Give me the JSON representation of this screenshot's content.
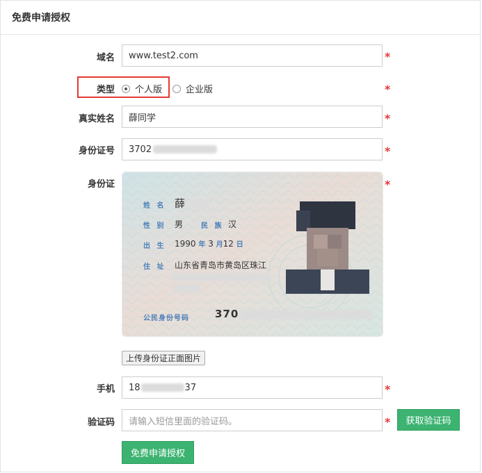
{
  "header": {
    "title": "免费申请授权"
  },
  "form": {
    "domain": {
      "label": "域名",
      "value": "www.test2.com"
    },
    "type": {
      "label": "类型",
      "options": [
        "个人版",
        "企业版"
      ],
      "selected": "个人版"
    },
    "realname": {
      "label": "真实姓名",
      "value": "薛同学"
    },
    "idnumber": {
      "label": "身份证号",
      "value": "3702"
    },
    "idcard": {
      "label": "身份证",
      "card": {
        "name_label": "姓 名",
        "name_value": "薛",
        "sex_label": "性 别",
        "sex_value": "男",
        "ethnic_label": "民 族",
        "ethnic_value": "汉",
        "birth_label": "出 生",
        "birth_year": "1990",
        "year_unit": "年",
        "birth_month": "3",
        "month_unit": "月",
        "birth_day": "12",
        "day_unit": "日",
        "addr_label": "住 址",
        "addr_value": "山东省青岛市黄岛区珠江",
        "idno_label": "公民身份号码",
        "idno_value": "370"
      }
    },
    "upload_button": "上传身份证正面图片",
    "phone": {
      "label": "手机",
      "prefix": "18",
      "suffix": "37"
    },
    "code": {
      "label": "验证码",
      "placeholder": "请输入短信里面的验证码。",
      "get_button": "获取验证码"
    },
    "required_mark": "*",
    "submit_button": "免费申请授权"
  },
  "colors": {
    "accent_green": "#3cb371",
    "required_red": "#e4393c",
    "highlight_red": "#e23a32"
  }
}
